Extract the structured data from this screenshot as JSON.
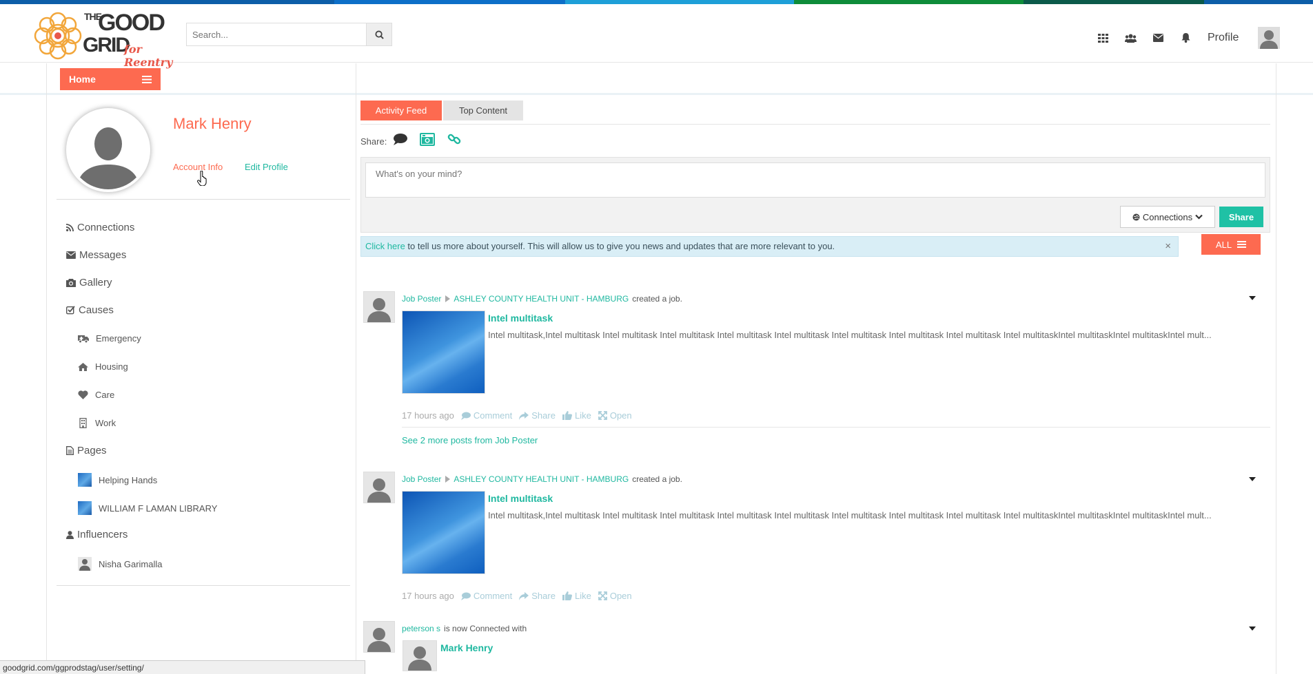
{
  "colors": {
    "accent": "#fd6a50",
    "teal": "#1fb8a0",
    "stripe": [
      "#0d5ea8",
      "#0d6fc8",
      "#1e9fd8",
      "#0e8c3a",
      "#0b5a4a",
      "#0d5ea8"
    ]
  },
  "logo": {
    "line1": "THE",
    "line2": "GOOD",
    "line3": "GRID",
    "tagline": "for Reentry"
  },
  "search": {
    "placeholder": "Search...",
    "icon": "search-icon"
  },
  "topnav": {
    "icons": [
      "apps-grid-icon",
      "users-icon",
      "envelope-icon",
      "bell-icon"
    ],
    "profile_label": "Profile"
  },
  "subbar": {
    "home_label": "Home",
    "home_icon": "list-icon"
  },
  "profile": {
    "name": "Mark Henry",
    "account_info": "Account Info",
    "edit_profile": "Edit Profile"
  },
  "sidebar": {
    "items": [
      {
        "label": "Connections",
        "icon": "rss-icon"
      },
      {
        "label": "Messages",
        "icon": "envelope-icon"
      },
      {
        "label": "Gallery",
        "icon": "camera-icon"
      },
      {
        "label": "Causes",
        "icon": "checkbox-icon"
      }
    ],
    "causes": [
      {
        "label": "Emergency",
        "icon": "ambulance-icon"
      },
      {
        "label": "Housing",
        "icon": "home-icon"
      },
      {
        "label": "Care",
        "icon": "heart-icon"
      },
      {
        "label": "Work",
        "icon": "building-icon"
      }
    ],
    "pages_label": "Pages",
    "pages": [
      {
        "label": "Helping Hands"
      },
      {
        "label": "WILLIAM F LAMAN LIBRARY"
      }
    ],
    "influencers_label": "Influencers",
    "influencers": [
      {
        "label": "Nisha Garimalla"
      }
    ]
  },
  "tabs": {
    "active": "Activity Feed",
    "other": "Top Content"
  },
  "share": {
    "label": "Share:",
    "placeholder": "What's on your mind?",
    "privacy": "Connections",
    "button": "Share"
  },
  "alert": {
    "link": "Click here",
    "text": " to tell us more about yourself. This will allow us to give you news and updates that are more relevant to you.",
    "close": "×"
  },
  "filter": {
    "label": "ALL"
  },
  "feed": [
    {
      "poster": "Job Poster",
      "org": "ASHLEY COUNTY HEALTH UNIT - HAMBURG",
      "verb": "created a job.",
      "title": "Intel multitask",
      "desc": "Intel multitask,Intel multitask Intel multitask Intel multitask Intel multitask Intel multitask Intel multitask Intel multitask Intel multitask  Intel multitaskIntel multitaskIntel multitaskIntel mult...",
      "time": "17 hours ago",
      "more": "See 2 more posts from Job Poster"
    },
    {
      "poster": "Job Poster",
      "org": "ASHLEY COUNTY HEALTH UNIT - HAMBURG",
      "verb": "created a job.",
      "title": "Intel multitask",
      "desc": "Intel multitask,Intel multitask Intel multitask Intel multitask Intel multitask Intel multitask Intel multitask Intel multitask Intel multitask  Intel multitaskIntel multitaskIntel multitaskIntel mult...",
      "time": "17 hours ago"
    }
  ],
  "actions": {
    "comment": "Comment",
    "share": "Share",
    "like": "Like",
    "open": "Open"
  },
  "connection_post": {
    "user": "peterson s",
    "text": "is now Connected with",
    "target": "Mark Henry"
  },
  "statusbar": {
    "url": "goodgrid.com/ggprodstag/user/setting/"
  }
}
